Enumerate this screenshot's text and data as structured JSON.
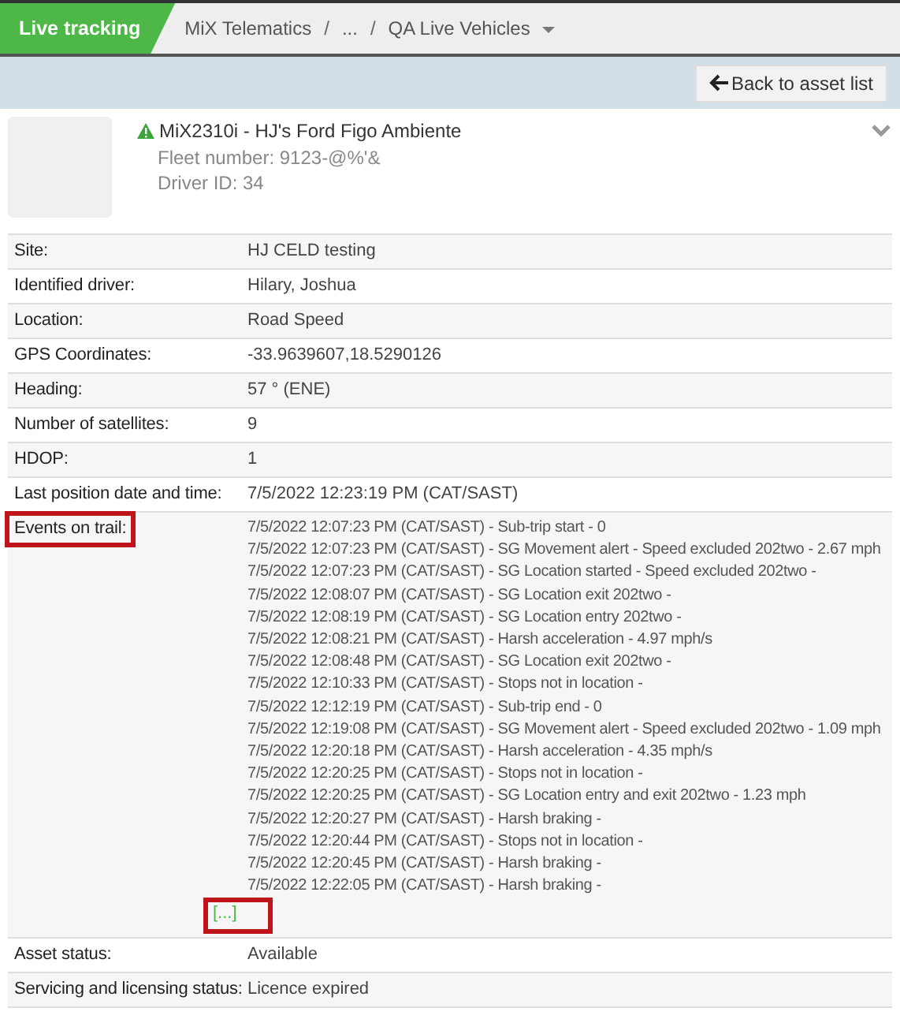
{
  "topbar": {
    "section": "Live tracking",
    "breadcrumbs": [
      "MiX Telematics",
      "...",
      "QA Live Vehicles"
    ],
    "separators": [
      "/",
      "/"
    ]
  },
  "toolbar": {
    "back_button": "Back to asset list"
  },
  "asset": {
    "title": "MiX2310i - HJ's Ford Figo Ambiente",
    "fleet_number": "Fleet number: 9123-@%'&",
    "driver_id": "Driver ID: 34",
    "expanded": false
  },
  "details": [
    {
      "kind": "text",
      "label": "Site:",
      "value": "HJ CELD testing",
      "highlighted": false
    },
    {
      "kind": "text",
      "label": "Identified driver:",
      "value": "Hilary, Joshua",
      "highlighted": false
    },
    {
      "kind": "text",
      "label": "Location:",
      "value": "Road Speed",
      "highlighted": false
    },
    {
      "kind": "text",
      "label": "GPS Coordinates:",
      "value": "-33.9639607,18.5290126",
      "highlighted": false
    },
    {
      "kind": "text",
      "label": "Heading:",
      "value": "57 ° (ENE)",
      "highlighted": false
    },
    {
      "kind": "text",
      "label": "Number of satellites:",
      "value": "9",
      "highlighted": false
    },
    {
      "kind": "text",
      "label": "HDOP:",
      "value": "1",
      "highlighted": false
    },
    {
      "kind": "text",
      "label": "Last position date and time:",
      "value": "7/5/2022 12:23:19 PM (CAT/SAST)",
      "highlighted": false
    },
    {
      "kind": "events",
      "label": "Events on trail:",
      "highlighted": true,
      "more_link": {
        "text": "[...]",
        "highlighted": true
      },
      "events": [
        "7/5/2022 12:07:23 PM (CAT/SAST) - Sub-trip start - 0",
        "7/5/2022 12:07:23 PM (CAT/SAST) - SG Movement alert - Speed excluded 202two - 2.67 mph",
        "7/5/2022 12:07:23 PM (CAT/SAST) - SG Location started - Speed excluded 202two -",
        "7/5/2022 12:08:07 PM (CAT/SAST) - SG Location exit 202two -",
        "7/5/2022 12:08:19 PM (CAT/SAST) - SG Location entry 202two -",
        "7/5/2022 12:08:21 PM (CAT/SAST) - Harsh acceleration - 4.97 mph/s",
        "7/5/2022 12:08:48 PM (CAT/SAST) - SG Location exit 202two -",
        "7/5/2022 12:10:33 PM (CAT/SAST) - Stops not in location -",
        "7/5/2022 12:12:19 PM (CAT/SAST) - Sub-trip end - 0",
        "7/5/2022 12:19:08 PM (CAT/SAST) - SG Movement alert - Speed excluded 202two - 1.09 mph",
        "7/5/2022 12:20:18 PM (CAT/SAST) - Harsh acceleration - 4.35 mph/s",
        "7/5/2022 12:20:25 PM (CAT/SAST) - Stops not in location -",
        "7/5/2022 12:20:25 PM (CAT/SAST) - SG Location entry and exit 202two - 1.23 mph",
        "7/5/2022 12:20:27 PM (CAT/SAST) - Harsh braking -",
        "7/5/2022 12:20:44 PM (CAT/SAST) - Stops not in location -",
        "7/5/2022 12:20:45 PM (CAT/SAST) - Harsh braking -",
        "7/5/2022 12:22:05 PM (CAT/SAST) - Harsh braking -"
      ]
    },
    {
      "kind": "text",
      "label": "Asset status:",
      "value": "Available",
      "highlighted": false
    },
    {
      "kind": "text",
      "label": "Servicing and licensing status:",
      "value": "Licence expired",
      "highlighted": false
    }
  ]
}
